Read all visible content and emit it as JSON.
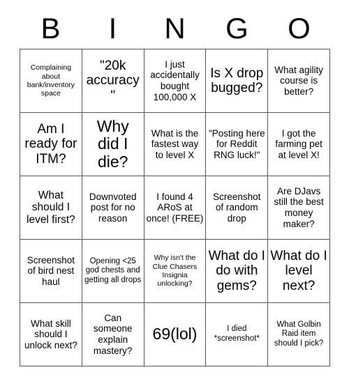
{
  "header": {
    "letters": [
      "B",
      "I",
      "N",
      "G",
      "O"
    ]
  },
  "grid": {
    "rows": 5,
    "columns": 5,
    "border_color": "#555555",
    "background_color": "#ffffff",
    "text_color": "#000000",
    "cells": [
      {
        "text": "Complaining about bank/inventory space",
        "size": "xs"
      },
      {
        "text": "\"20k accuracy\"",
        "size": "xl"
      },
      {
        "text": "I just accidentally bought 100,000 X",
        "size": "m"
      },
      {
        "text": "Is X drop bugged?",
        "size": "xl"
      },
      {
        "text": "What agility course is better?",
        "size": "m"
      },
      {
        "text": "Am I ready for ITM?",
        "size": "xl"
      },
      {
        "text": "Why did I die?",
        "size": "xxl"
      },
      {
        "text": "What is the fastest way to level X",
        "size": "m"
      },
      {
        "text": "\"Posting here for Reddit RNG luck!\"",
        "size": "m"
      },
      {
        "text": "I got the farming pet at level X!",
        "size": "m"
      },
      {
        "text": "What should I level first?",
        "size": "l"
      },
      {
        "text": "Downvoted post for no reason",
        "size": "m"
      },
      {
        "text": "I found 4 ARoS at once! (FREE)",
        "size": "m"
      },
      {
        "text": "Screenshot of random drop",
        "size": "m"
      },
      {
        "text": "Are DJavs still the best money maker?",
        "size": "m"
      },
      {
        "text": "Screenshot of bird nest haul",
        "size": "m"
      },
      {
        "text": "Opening <25 god chests and getting all drops",
        "size": "s"
      },
      {
        "text": "Why isn't the Clue Chasers Insignia unlocking?",
        "size": "xs"
      },
      {
        "text": "What do I do with gems?",
        "size": "xl"
      },
      {
        "text": "What do I level next?",
        "size": "xl"
      },
      {
        "text": "What skill should I unlock next?",
        "size": "m"
      },
      {
        "text": "Can someone explain mastery?",
        "size": "m"
      },
      {
        "text": "69(lol)",
        "size": "xxl"
      },
      {
        "text": "I died *screenshot*",
        "size": "s"
      },
      {
        "text": "What Golbin Raid item should I pick?",
        "size": "s"
      }
    ]
  }
}
